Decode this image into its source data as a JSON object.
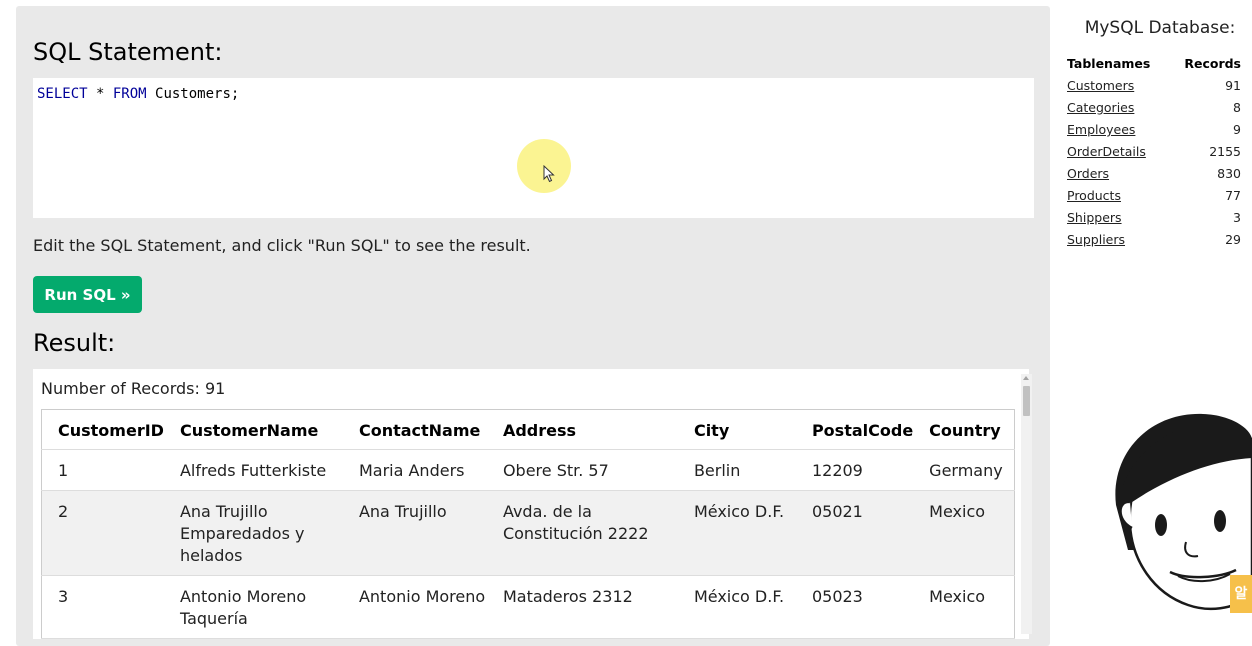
{
  "editor": {
    "title": "SQL Statement:",
    "sql_keyword_select": "SELECT",
    "sql_star": " * ",
    "sql_keyword_from": "FROM",
    "sql_rest": " Customers;",
    "hint": "Edit the SQL Statement, and click \"Run SQL\" to see the result.",
    "run_label": "Run SQL »"
  },
  "result": {
    "title": "Result:",
    "record_count": "Number of Records: 91",
    "columns": [
      "CustomerID",
      "CustomerName",
      "ContactName",
      "Address",
      "City",
      "PostalCode",
      "Country"
    ],
    "rows": [
      [
        "1",
        "Alfreds Futterkiste",
        "Maria Anders",
        "Obere Str. 57",
        "Berlin",
        "12209",
        "Germany"
      ],
      [
        "2",
        "Ana Trujillo Emparedados y helados",
        "Ana Trujillo",
        "Avda. de la Constitución 2222",
        "México D.F.",
        "05021",
        "Mexico"
      ],
      [
        "3",
        "Antonio Moreno Taquería",
        "Antonio Moreno",
        "Mataderos 2312",
        "México D.F.",
        "05023",
        "Mexico"
      ]
    ]
  },
  "database": {
    "title": "MySQL Database:",
    "header_tablenames": "Tablenames",
    "header_records": "Records",
    "tables": [
      {
        "name": "Customers",
        "records": "91"
      },
      {
        "name": "Categories",
        "records": "8"
      },
      {
        "name": "Employees",
        "records": "9"
      },
      {
        "name": "OrderDetails",
        "records": "2155"
      },
      {
        "name": "Orders",
        "records": "830"
      },
      {
        "name": "Products",
        "records": "77"
      },
      {
        "name": "Shippers",
        "records": "3"
      },
      {
        "name": "Suppliers",
        "records": "29"
      }
    ]
  },
  "mascot": {
    "badge_text": "알"
  },
  "colors": {
    "run_button": "#04aa6d",
    "panel_bg": "#e9e9e9",
    "cursor_highlight": "#faf06e"
  }
}
